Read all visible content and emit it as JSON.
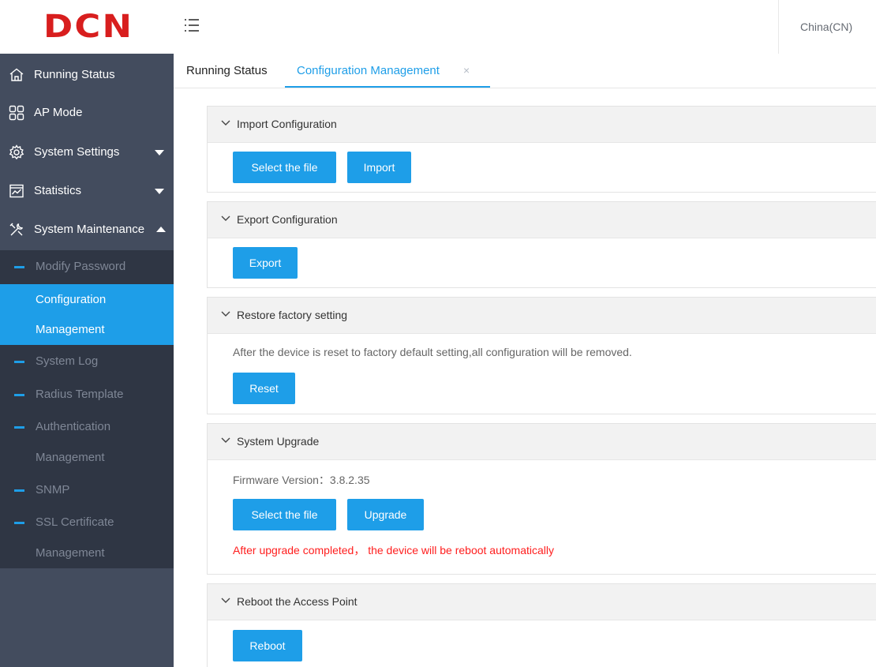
{
  "brand": {
    "logo_text": "DCN",
    "logo_color": "#d81e1e"
  },
  "colors": {
    "accent": "#1e9ee8",
    "sidebar_bg": "#434c5e",
    "submenu_bg": "#2f3644",
    "warning": "#ff1e1e"
  },
  "header": {
    "menu_icon": "hamburger-icon",
    "language": "China(CN)"
  },
  "sidebar": {
    "items": [
      {
        "label": "Running Status",
        "icon": "home-icon"
      },
      {
        "label": "AP Mode",
        "icon": "grid-icon"
      },
      {
        "label": "System Settings",
        "icon": "gear-icon",
        "caret": "down"
      },
      {
        "label": "Statistics",
        "icon": "chart-icon",
        "caret": "down"
      },
      {
        "label": "System Maintenance",
        "icon": "tools-icon",
        "caret": "up"
      }
    ],
    "submenu": [
      {
        "lines": [
          "Modify Password"
        ],
        "active": false
      },
      {
        "lines": [
          "Configuration",
          "Management"
        ],
        "active": true
      },
      {
        "lines": [
          "System Log"
        ],
        "active": false
      },
      {
        "lines": [
          "Radius Template"
        ],
        "active": false
      },
      {
        "lines": [
          "Authentication",
          "Management"
        ],
        "active": false
      },
      {
        "lines": [
          "SNMP"
        ],
        "active": false
      },
      {
        "lines": [
          "SSL Certificate",
          "Management"
        ],
        "active": false
      }
    ]
  },
  "tabs": [
    {
      "label": "Running Status",
      "active": false
    },
    {
      "label": "Configuration Management",
      "active": true,
      "close": "×"
    }
  ],
  "panels": {
    "import": {
      "title": "Import Configuration",
      "select_label": "Select the file",
      "import_label": "Import"
    },
    "export": {
      "title": "Export Configuration",
      "export_label": "Export"
    },
    "restore": {
      "title": "Restore factory setting",
      "description": "After the device is reset to factory default setting,all configuration will be removed.",
      "reset_label": "Reset"
    },
    "upgrade": {
      "title": "System Upgrade",
      "firmware": "Firmware Version：3.8.2.35",
      "select_label": "Select the file",
      "upgrade_label": "Upgrade",
      "warning": "After upgrade completed， the device will be reboot automatically"
    },
    "reboot": {
      "title": "Reboot the Access Point",
      "reboot_label": "Reboot"
    }
  }
}
